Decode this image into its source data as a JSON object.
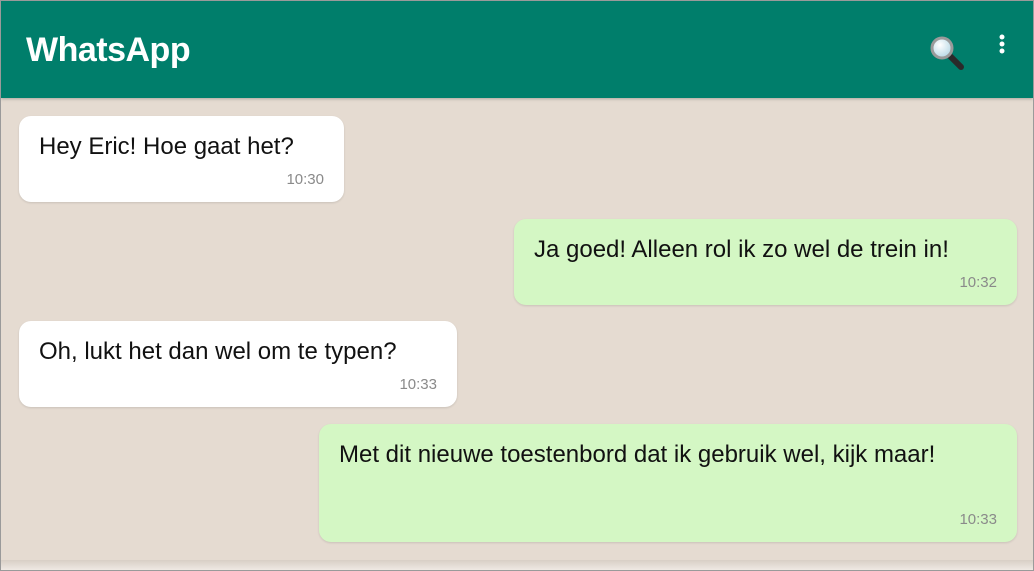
{
  "header": {
    "title": "WhatsApp",
    "search_icon": "search-icon",
    "menu_icon": "more-vertical-icon"
  },
  "colors": {
    "header": "#007e6b",
    "background": "#e5dbd1",
    "incoming_bubble": "#ffffff",
    "outgoing_bubble": "#d4f7c4"
  },
  "messages": [
    {
      "direction": "incoming",
      "text": "Hey Eric! Hoe gaat het?",
      "time": "10:30"
    },
    {
      "direction": "outgoing",
      "text": "Ja goed! Alleen rol ik zo wel de trein in!",
      "time": "10:32"
    },
    {
      "direction": "incoming",
      "text": "Oh, lukt het dan wel om te typen?",
      "time": "10:33"
    },
    {
      "direction": "outgoing",
      "text": "Met dit nieuwe toestenbord dat ik gebruik wel, kijk maar!",
      "time": "10:33"
    }
  ]
}
